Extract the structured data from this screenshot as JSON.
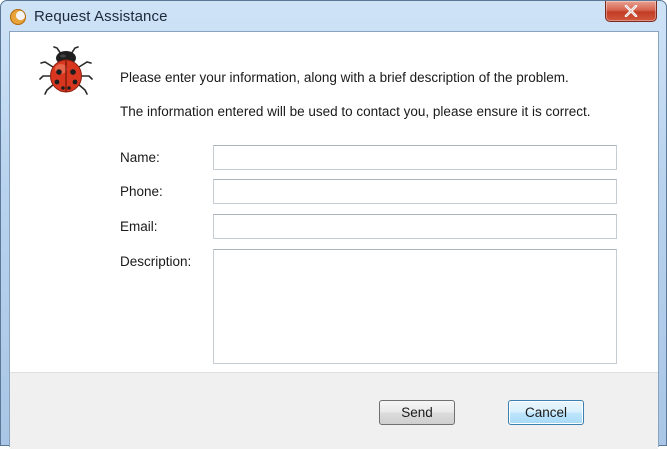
{
  "window": {
    "title": "Request Assistance"
  },
  "intro": {
    "line1": "Please enter your information, along with a brief description of the problem.",
    "line2": "The information entered will be used to contact you, please ensure it is correct."
  },
  "form": {
    "name_label": "Name:",
    "name_value": "",
    "phone_label": "Phone:",
    "phone_value": "",
    "email_label": "Email:",
    "email_value": "",
    "description_label": "Description:",
    "description_value": ""
  },
  "buttons": {
    "send_label": "Send",
    "cancel_label": "Cancel"
  },
  "icons": {
    "app": "crescent-logo-icon",
    "bug": "ladybug-icon",
    "close": "close-icon"
  },
  "colors": {
    "title_bar": "#b9d3ee",
    "close_button": "#c23d25",
    "footer": "#f0f0f0",
    "default_button_border": "#3c7fb1"
  }
}
